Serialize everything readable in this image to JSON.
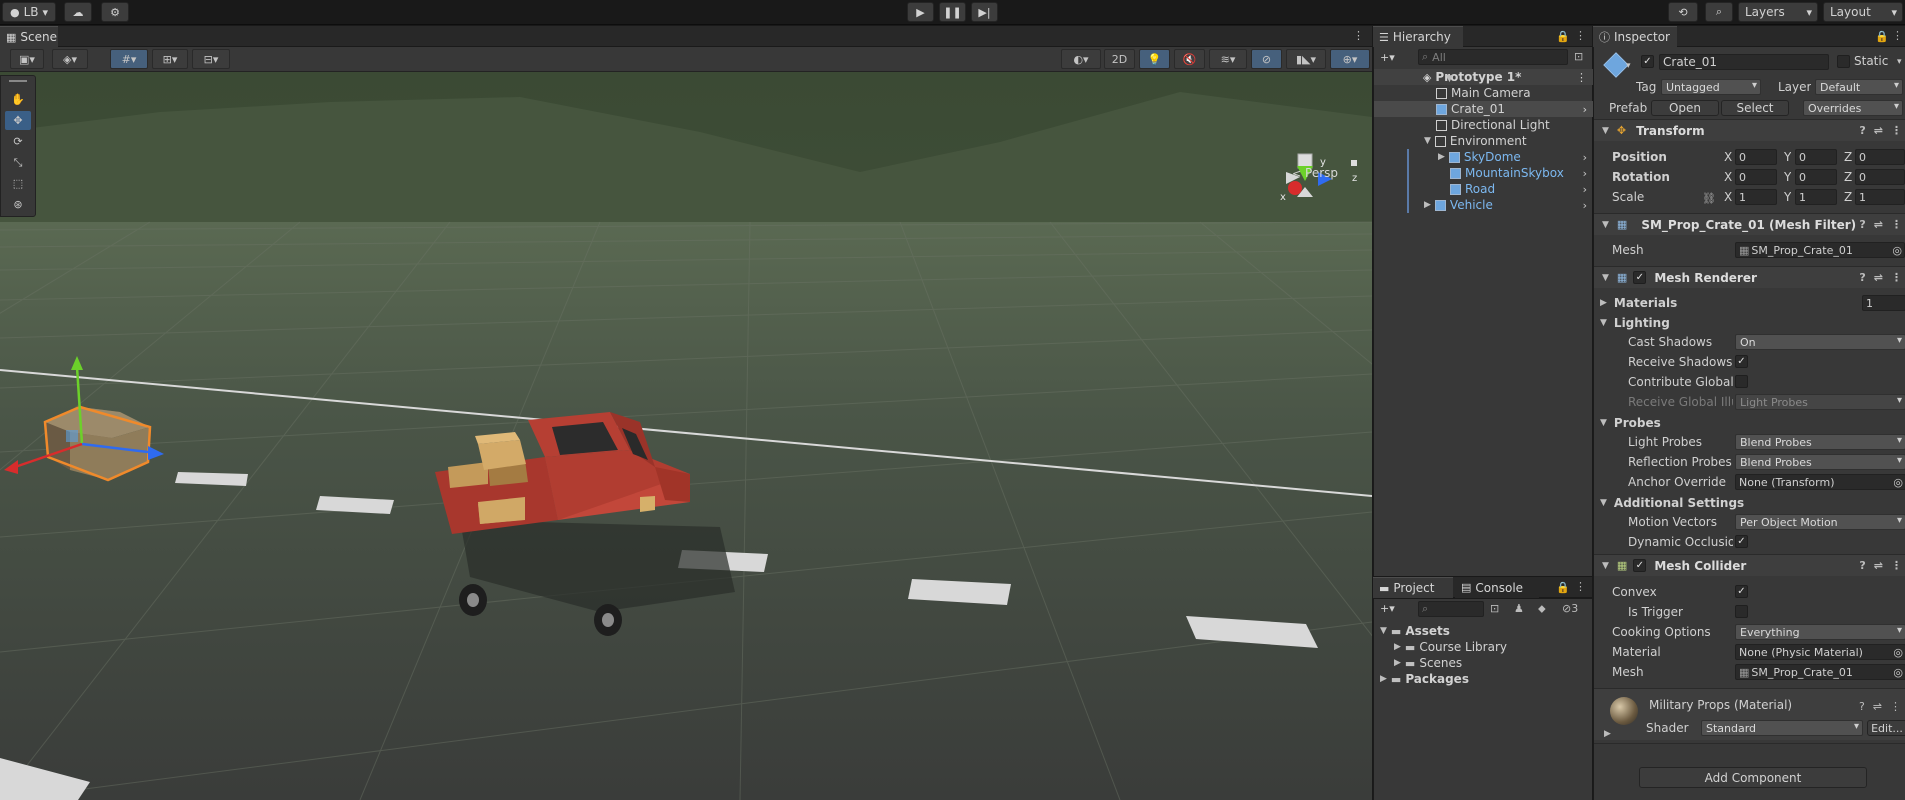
{
  "topbar": {
    "account": "LB",
    "layers": "Layers",
    "layout": "Layout"
  },
  "scene": {
    "tab": "Scene",
    "toggle_2d": "2D",
    "persp": "Persp",
    "gizmo_y": "y",
    "gizmo_z": "z",
    "gizmo_x": "x"
  },
  "hierarchy": {
    "tab": "Hierarchy",
    "search_placeholder": "All",
    "scene_name": "Prototype 1*",
    "items": [
      {
        "label": "Main Camera"
      },
      {
        "label": "Crate_01"
      },
      {
        "label": "Directional Light"
      },
      {
        "label": "Environment"
      },
      {
        "label": "SkyDome"
      },
      {
        "label": "MountainSkybox"
      },
      {
        "label": "Road"
      },
      {
        "label": "Vehicle"
      }
    ]
  },
  "project": {
    "tabs": [
      "Project",
      "Console"
    ],
    "hidden_count": "3",
    "tree": [
      {
        "label": "Assets"
      },
      {
        "label": "Course Library"
      },
      {
        "label": "Scenes"
      },
      {
        "label": "Packages"
      }
    ]
  },
  "inspector": {
    "tab": "Inspector",
    "object_name": "Crate_01",
    "static_label": "Static",
    "tag_label": "Tag",
    "tag_value": "Untagged",
    "layer_label": "Layer",
    "layer_value": "Default",
    "prefab_label": "Prefab",
    "prefab_open": "Open",
    "prefab_select": "Select",
    "prefab_overrides": "Overrides",
    "transform": {
      "title": "Transform",
      "position_label": "Position",
      "rotation_label": "Rotation",
      "scale_label": "Scale",
      "axis_x": "X",
      "axis_y": "Y",
      "axis_z": "Z",
      "position": [
        "0",
        "0",
        "0"
      ],
      "rotation": [
        "0",
        "0",
        "0"
      ],
      "scale": [
        "1",
        "1",
        "1"
      ]
    },
    "mesh_filter": {
      "title": "SM_Prop_Crate_01 (Mesh Filter)",
      "mesh_label": "Mesh",
      "mesh_value": "SM_Prop_Crate_01"
    },
    "mesh_renderer": {
      "title": "Mesh Renderer",
      "materials_label": "Materials",
      "materials_count": "1",
      "lighting_label": "Lighting",
      "cast_shadows_label": "Cast Shadows",
      "cast_shadows_value": "On",
      "receive_shadows_label": "Receive Shadows",
      "contribute_gi_label": "Contribute Global I",
      "receive_gi_label": "Receive Global Illu",
      "receive_gi_value": "Light Probes",
      "probes_label": "Probes",
      "light_probes_label": "Light Probes",
      "light_probes_value": "Blend Probes",
      "reflection_probes_label": "Reflection Probes",
      "reflection_probes_value": "Blend Probes",
      "anchor_override_label": "Anchor Override",
      "anchor_override_value": "None (Transform)",
      "additional_label": "Additional Settings",
      "motion_vectors_label": "Motion Vectors",
      "motion_vectors_value": "Per Object Motion",
      "dynamic_occlusion_label": "Dynamic Occlusio"
    },
    "mesh_collider": {
      "title": "Mesh Collider",
      "convex_label": "Convex",
      "is_trigger_label": "Is Trigger",
      "cooking_label": "Cooking Options",
      "cooking_value": "Everything",
      "material_label": "Material",
      "material_value": "None (Physic Material)",
      "mesh_label": "Mesh",
      "mesh_value": "SM_Prop_Crate_01"
    },
    "material": {
      "title": "Military Props (Material)",
      "shader_label": "Shader",
      "shader_value": "Standard",
      "edit_label": "Edit..."
    },
    "add_component": "Add Component"
  },
  "colors": {
    "accent": "#3a5f87",
    "selection_orange": "#f08a2b",
    "prefab_blue": "#7cb8f0"
  }
}
